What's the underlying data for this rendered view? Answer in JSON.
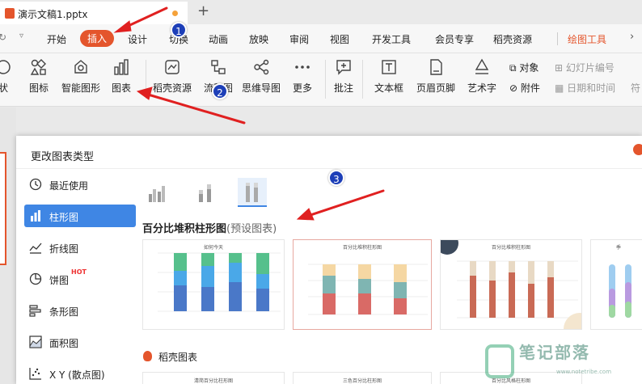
{
  "app": {
    "tab_title": "演示文稿1.pptx",
    "new_tab": "+"
  },
  "menu": {
    "items": [
      "开始",
      "插入",
      "设计",
      "切换",
      "动画",
      "放映",
      "审阅",
      "视图",
      "开发工具",
      "会员专享",
      "稻壳资源",
      "绘图工具"
    ],
    "active": "插入",
    "highlight": "绘图工具",
    "more": "›"
  },
  "toolbar": {
    "shapes_label": "状",
    "icons_label": "图标",
    "smart_label": "智能图形",
    "chart_label": "图表",
    "docer_label": "稻壳资源",
    "flow_label": "流程图",
    "mind_label": "思维导图",
    "more_label": "更多",
    "comment_label": "批注",
    "textbox_label": "文本框",
    "headerfooter_label": "页眉页脚",
    "wordart_label": "艺术字",
    "object_label": "对象",
    "attachment_label": "附件",
    "slide_number_label": "幻灯片编号",
    "datetime_label": "日期和时间",
    "symbol_label": "符"
  },
  "dialog": {
    "title": "更改图表类型",
    "categories": [
      {
        "label": "最近使用",
        "icon": "clock-icon"
      },
      {
        "label": "柱形图",
        "icon": "column-chart-icon"
      },
      {
        "label": "折线图",
        "icon": "line-chart-icon"
      },
      {
        "label": "饼图",
        "icon": "pie-chart-icon",
        "badge": "HOT"
      },
      {
        "label": "条形图",
        "icon": "bar-chart-icon"
      },
      {
        "label": "面积图",
        "icon": "area-chart-icon"
      },
      {
        "label": "X Y (散点图)",
        "icon": "scatter-chart-icon"
      }
    ],
    "selected_category": "柱形图",
    "section_title": "百分比堆积柱形图",
    "section_suffix": "(预设图表)",
    "preset_cards": [
      {
        "title": "如何今天"
      },
      {
        "title": "百分比堆积柱形图"
      },
      {
        "title": "百分比堆积柱形图"
      },
      {
        "title": "季"
      }
    ],
    "docer_section_title": "稻壳图表",
    "docer_cards": [
      {
        "title": "清简百分比柱形图"
      },
      {
        "title": "三色百分比柱形图"
      },
      {
        "title": "百分比风格柱形图"
      }
    ]
  },
  "annotations": {
    "steps": [
      "1",
      "2",
      "3"
    ],
    "color": "#1d3fb8",
    "arrow_color": "#e02020"
  },
  "watermark": {
    "text": "笔记部落",
    "url": "www.notetribe.com"
  },
  "colors": {
    "accent": "#e4552c",
    "selection": "#3f86e4"
  }
}
